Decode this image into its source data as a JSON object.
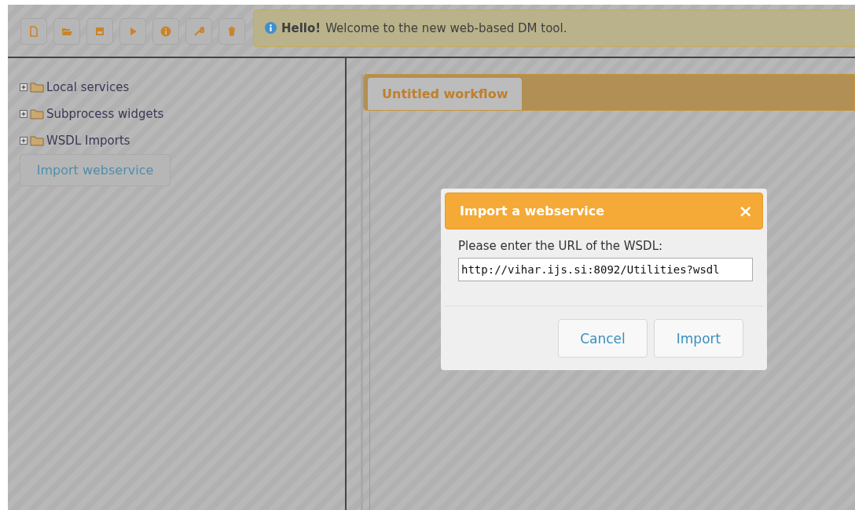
{
  "toolbar": [
    {
      "kind": "new"
    },
    {
      "kind": "open"
    },
    {
      "kind": "save"
    },
    {
      "kind": "run"
    },
    {
      "kind": "info"
    },
    {
      "kind": "settings"
    },
    {
      "kind": "delete"
    }
  ],
  "alert": {
    "title": "Hello!",
    "message": "Welcome to the new web-based DM tool."
  },
  "tree": [
    {
      "label": "Local services",
      "expanded": false
    },
    {
      "label": "Subprocess widgets",
      "expanded": false
    },
    {
      "label": "WSDL Imports",
      "expanded": false
    }
  ],
  "import_button": "Import webservice",
  "tabs": [
    {
      "label": "Untitled workflow",
      "selected": true
    }
  ],
  "dialog": {
    "title": "Import a webservice",
    "close": "×",
    "prompt": "Please enter the URL of the WSDL:",
    "url": "http://vihar.ijs.si:8092/Utilities?wsdl",
    "buttons": [
      "Cancel",
      "Import"
    ]
  }
}
